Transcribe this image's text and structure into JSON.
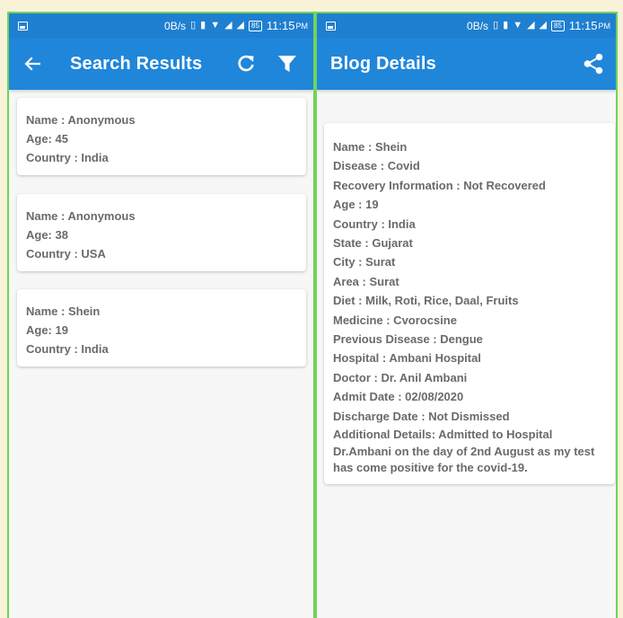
{
  "status_bar": {
    "data_speed": "0B/s",
    "battery": "85",
    "time": "11:15",
    "ampm": "PM"
  },
  "search_screen": {
    "title": "Search Results",
    "icons": [
      "back-arrow-icon",
      "refresh-icon",
      "filter-icon"
    ],
    "results": [
      {
        "name": "Name : Anonymous",
        "age": "Age: 45",
        "country": "Country : India"
      },
      {
        "name": "Name : Anonymous",
        "age": "Age: 38",
        "country": "Country : USA"
      },
      {
        "name": "Name : Shein",
        "age": "Age: 19",
        "country": "Country : India"
      }
    ]
  },
  "detail_screen": {
    "title": "Blog Details",
    "icons": [
      "share-icon"
    ],
    "fields": [
      "Name : Shein",
      "Disease : Covid",
      "Recovery Information : Not Recovered",
      "Age : 19",
      "Country : India",
      "State : Gujarat",
      "City : Surat",
      "Area : Surat",
      "Diet : Milk, Roti, Rice, Daal, Fruits",
      "Medicine : Cvorocsine",
      "Previous Disease : Dengue",
      "Hospital : Ambani Hospital",
      "Doctor : Dr. Anil Ambani",
      "Admit Date : 02/08/2020",
      "Discharge Date : Not Dismissed"
    ],
    "additional": "Additional Details: Admitted to Hospital Dr.Ambani on the day of 2nd August as my test has come positive for the covid-19."
  },
  "colors": {
    "app_bar": "#1f86da",
    "status_bar": "#1f7fd0",
    "frame": "#6fd35a",
    "text": "#6a6a6a"
  }
}
